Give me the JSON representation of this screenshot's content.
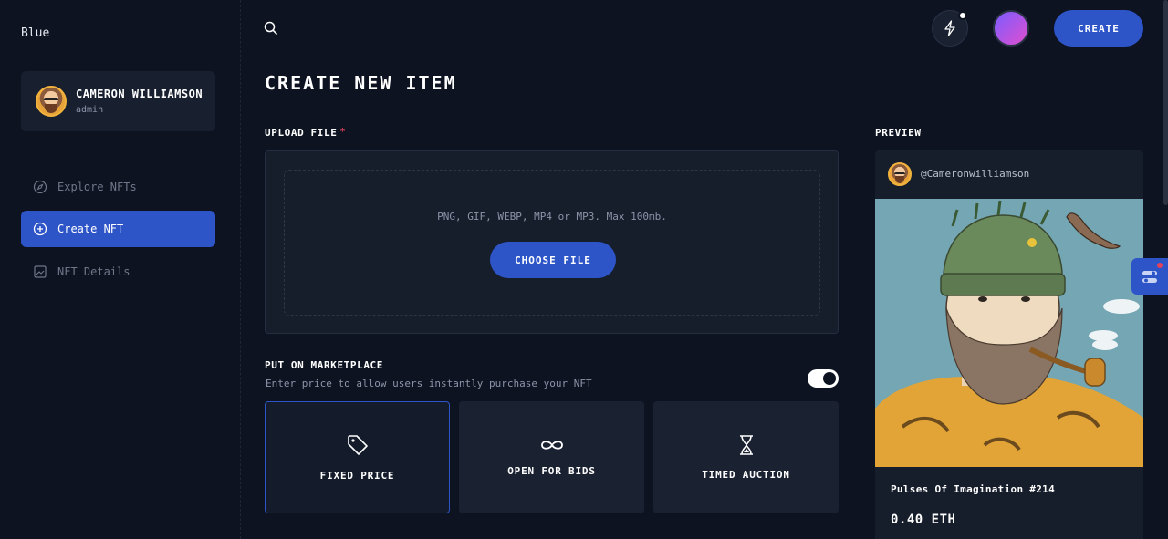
{
  "brand": "Blue",
  "user": {
    "name": "CAMERON WILLIAMSON",
    "role": "admin"
  },
  "nav": {
    "explore": "Explore NFTs",
    "create": "Create NFT",
    "details": "NFT Details"
  },
  "topbar": {
    "create_label": "CREATE"
  },
  "page": {
    "title": "CREATE NEW ITEM"
  },
  "upload": {
    "label": "UPLOAD FILE",
    "required_mark": "*",
    "hint": "PNG, GIF, WEBP, MP4 or MP3. Max 100mb.",
    "button": "CHOOSE FILE"
  },
  "marketplace": {
    "label": "PUT ON MARKETPLACE",
    "subtitle": "Enter price to allow users instantly purchase your NFT",
    "enabled": true,
    "options": [
      {
        "label": "FIXED PRICE",
        "icon": "tag-icon",
        "selected": true
      },
      {
        "label": "OPEN FOR BIDS",
        "icon": "infinity-icon",
        "selected": false
      },
      {
        "label": "TIMED AUCTION",
        "icon": "hourglass-icon",
        "selected": false
      }
    ]
  },
  "preview": {
    "label": "PREVIEW",
    "handle": "@Cameronwilliamson",
    "title": "Pulses Of Imagination #214",
    "price": "0.40 ETH"
  },
  "colors": {
    "background": "#0d1321",
    "accent": "#2d55c8",
    "card": "#1a2130",
    "required": "#e0435b"
  }
}
